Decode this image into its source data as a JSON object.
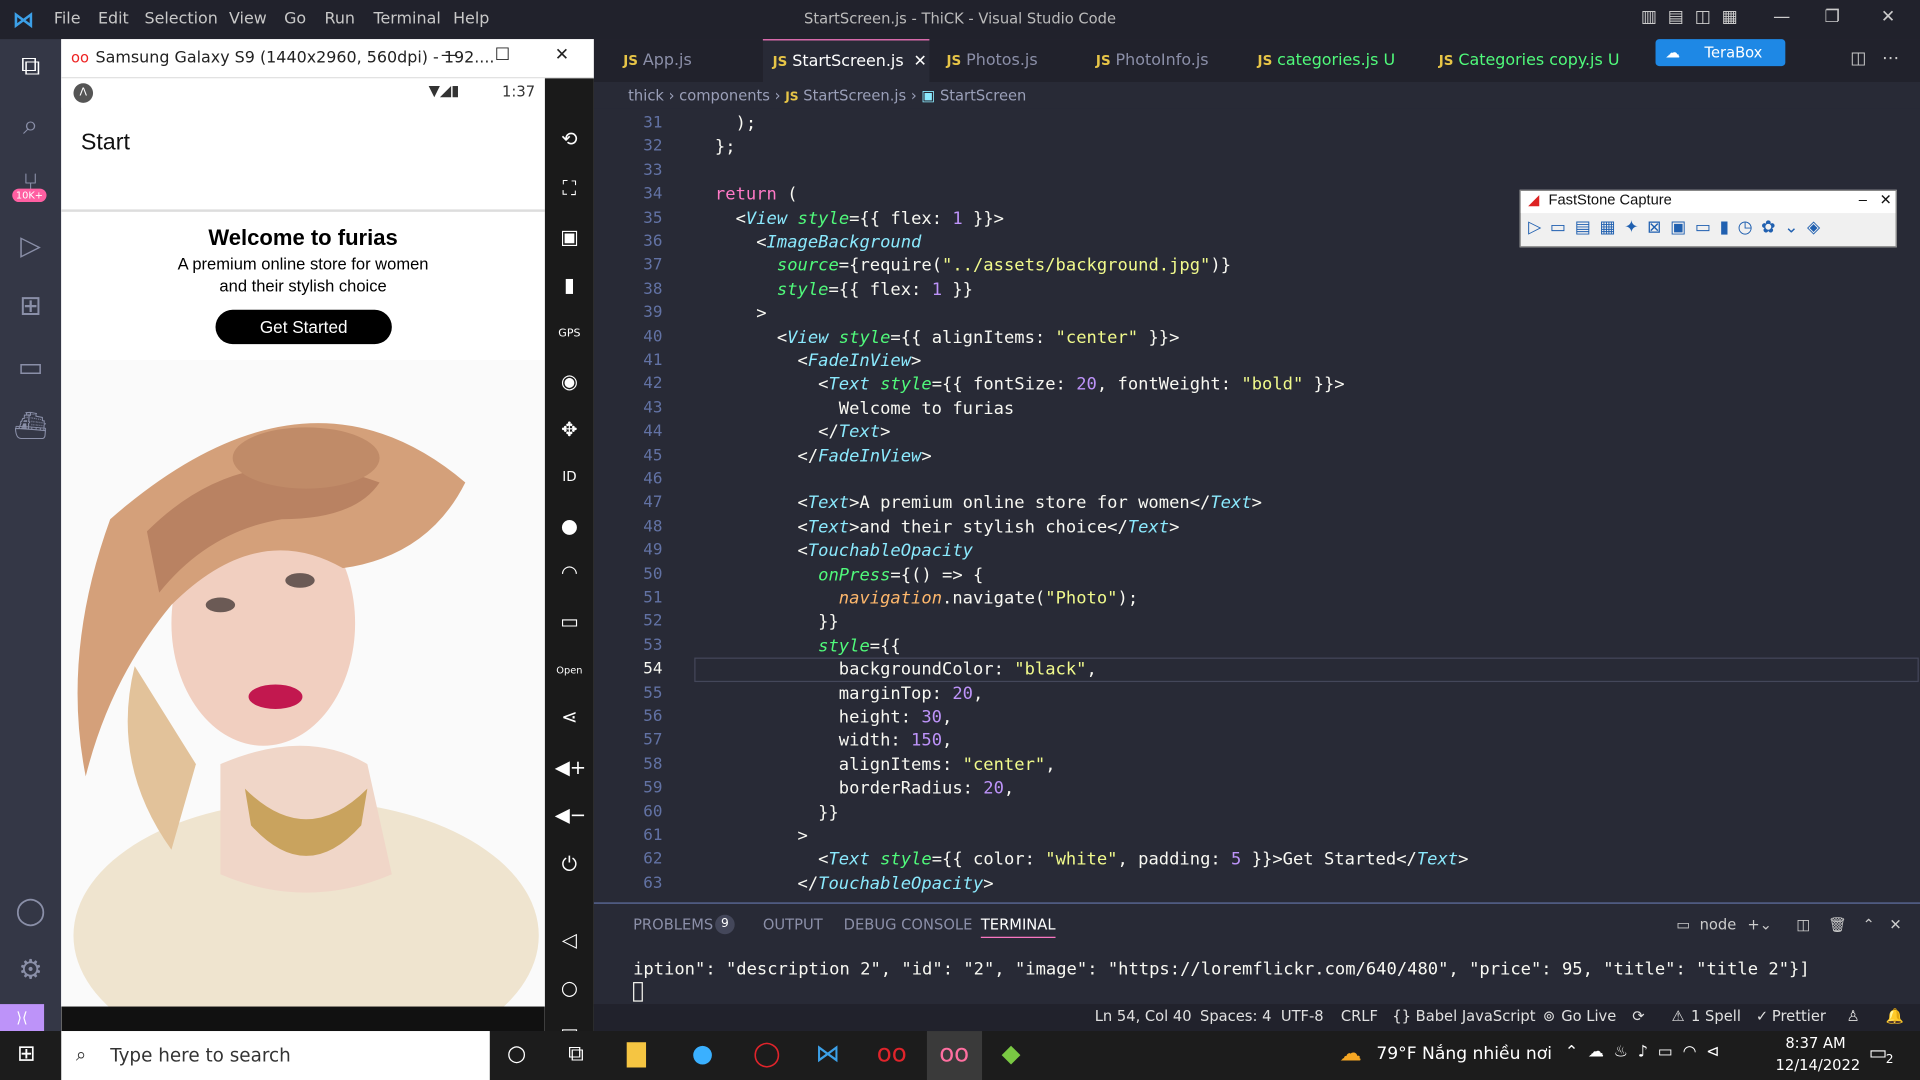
{
  "menu": [
    "File",
    "Edit",
    "Selection",
    "View",
    "Go",
    "Run",
    "Terminal",
    "Help"
  ],
  "window_title": "StartScreen.js - ThiCK - Visual Studio Code",
  "terabox": "TeraBox",
  "activity_badge": "10K+",
  "emulator": {
    "title": "Samsung Galaxy S9 (1440x2960, 560dpi) - 192....",
    "time": "1:37",
    "header": "Start",
    "welcome": "Welcome to furias",
    "line1": "A premium online store for women",
    "line2": "and their stylish choice",
    "button": "Get Started"
  },
  "tabs": [
    {
      "label": "App.js",
      "mark": ""
    },
    {
      "label": "StartScreen.js",
      "mark": ""
    },
    {
      "label": "Photos.js",
      "mark": ""
    },
    {
      "label": "PhotoInfo.js",
      "mark": ""
    },
    {
      "label": "categories.js",
      "mark": "U"
    },
    {
      "label": "Categories copy.js",
      "mark": "U"
    }
  ],
  "breadcrumb": {
    "a": "thick",
    "b": "components",
    "c": "StartScreen.js",
    "d": "StartScreen"
  },
  "faststone_title": "FastStone Capture",
  "code": [
    {
      "n": "31",
      "t": "    );"
    },
    {
      "n": "32",
      "t": "  };"
    },
    {
      "n": "33",
      "t": ""
    },
    {
      "n": "34",
      "t": "  return ("
    },
    {
      "n": "35",
      "t": "    <View style={{ flex: 1 }}>"
    },
    {
      "n": "36",
      "t": "      <ImageBackground"
    },
    {
      "n": "37",
      "t": "        source={require(\"../assets/background.jpg\")}"
    },
    {
      "n": "38",
      "t": "        style={{ flex: 1 }}"
    },
    {
      "n": "39",
      "t": "      >"
    },
    {
      "n": "40",
      "t": "        <View style={{ alignItems: \"center\" }}>"
    },
    {
      "n": "41",
      "t": "          <FadeInView>"
    },
    {
      "n": "42",
      "t": "            <Text style={{ fontSize: 20, fontWeight: \"bold\" }}>"
    },
    {
      "n": "43",
      "t": "              Welcome to furias"
    },
    {
      "n": "44",
      "t": "            </Text>"
    },
    {
      "n": "45",
      "t": "          </FadeInView>"
    },
    {
      "n": "46",
      "t": ""
    },
    {
      "n": "47",
      "t": "          <Text>A premium online store for women</Text>"
    },
    {
      "n": "48",
      "t": "          <Text>and their stylish choice</Text>"
    },
    {
      "n": "49",
      "t": "          <TouchableOpacity"
    },
    {
      "n": "50",
      "t": "            onPress={() => {"
    },
    {
      "n": "51",
      "t": "              navigation.navigate(\"Photo\");"
    },
    {
      "n": "52",
      "t": "            }}"
    },
    {
      "n": "53",
      "t": "            style={{"
    },
    {
      "n": "54",
      "t": "              backgroundColor: \"black\","
    },
    {
      "n": "55",
      "t": "              marginTop: 20,"
    },
    {
      "n": "56",
      "t": "              height: 30,"
    },
    {
      "n": "57",
      "t": "              width: 150,"
    },
    {
      "n": "58",
      "t": "              alignItems: \"center\","
    },
    {
      "n": "59",
      "t": "              borderRadius: 20,"
    },
    {
      "n": "60",
      "t": "            }}"
    },
    {
      "n": "61",
      "t": "          >"
    },
    {
      "n": "62",
      "t": "            <Text style={{ color: \"white\", padding: 5 }}>Get Started</Text>"
    },
    {
      "n": "63",
      "t": "          </TouchableOpacity>"
    }
  ],
  "panel": {
    "problems": "PROBLEMS",
    "problems_count": "9",
    "output": "OUTPUT",
    "debug": "DEBUG CONSOLE",
    "terminal": "TERMINAL",
    "shell": "node",
    "terminal_line": "iption\": \"description 2\", \"id\": \"2\", \"image\": \"https://loremflickr.com/640/480\", \"price\": 95, \"title\": \"title 2\"}]"
  },
  "status": {
    "pos": "Ln 54, Col 40",
    "spaces": "Spaces: 4",
    "enc": "UTF-8",
    "eol": "CRLF",
    "lang": "{} Babel JavaScript",
    "golive": "Go Live",
    "spell": "1 Spell",
    "prettier": "Prettier"
  },
  "taskbar": {
    "search": "Type here to search",
    "weather": "79°F  Nắng nhiều nơi",
    "time": "8:37 AM",
    "date": "12/14/2022",
    "notif": "2"
  }
}
